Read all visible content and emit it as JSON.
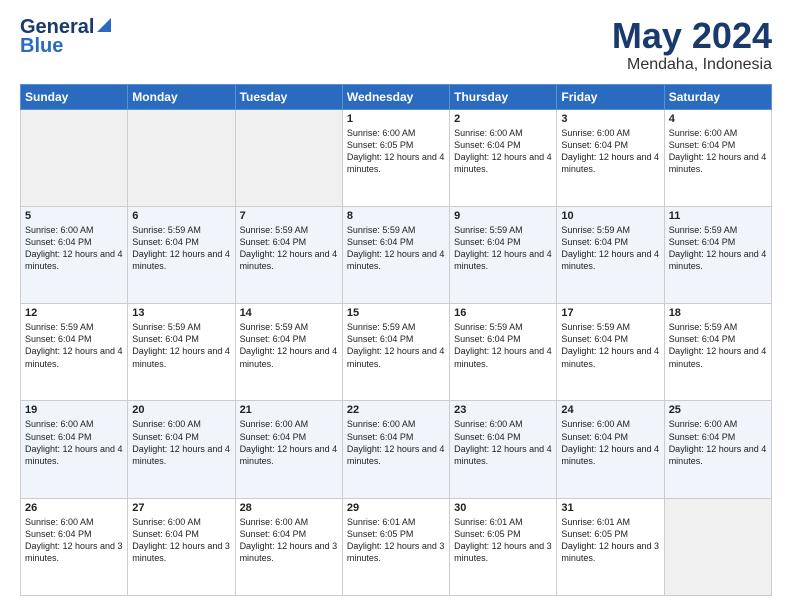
{
  "logo": {
    "line1": "General",
    "line2": "Blue"
  },
  "title": "May 2024",
  "location": "Mendaha, Indonesia",
  "days_header": [
    "Sunday",
    "Monday",
    "Tuesday",
    "Wednesday",
    "Thursday",
    "Friday",
    "Saturday"
  ],
  "weeks": [
    [
      {
        "day": "",
        "empty": true
      },
      {
        "day": "",
        "empty": true
      },
      {
        "day": "",
        "empty": true
      },
      {
        "day": "1",
        "sunrise": "6:00 AM",
        "sunset": "6:05 PM",
        "daylight": "12 hours and 4 minutes."
      },
      {
        "day": "2",
        "sunrise": "6:00 AM",
        "sunset": "6:04 PM",
        "daylight": "12 hours and 4 minutes."
      },
      {
        "day": "3",
        "sunrise": "6:00 AM",
        "sunset": "6:04 PM",
        "daylight": "12 hours and 4 minutes."
      },
      {
        "day": "4",
        "sunrise": "6:00 AM",
        "sunset": "6:04 PM",
        "daylight": "12 hours and 4 minutes."
      }
    ],
    [
      {
        "day": "5",
        "sunrise": "6:00 AM",
        "sunset": "6:04 PM",
        "daylight": "12 hours and 4 minutes."
      },
      {
        "day": "6",
        "sunrise": "5:59 AM",
        "sunset": "6:04 PM",
        "daylight": "12 hours and 4 minutes."
      },
      {
        "day": "7",
        "sunrise": "5:59 AM",
        "sunset": "6:04 PM",
        "daylight": "12 hours and 4 minutes."
      },
      {
        "day": "8",
        "sunrise": "5:59 AM",
        "sunset": "6:04 PM",
        "daylight": "12 hours and 4 minutes."
      },
      {
        "day": "9",
        "sunrise": "5:59 AM",
        "sunset": "6:04 PM",
        "daylight": "12 hours and 4 minutes."
      },
      {
        "day": "10",
        "sunrise": "5:59 AM",
        "sunset": "6:04 PM",
        "daylight": "12 hours and 4 minutes."
      },
      {
        "day": "11",
        "sunrise": "5:59 AM",
        "sunset": "6:04 PM",
        "daylight": "12 hours and 4 minutes."
      }
    ],
    [
      {
        "day": "12",
        "sunrise": "5:59 AM",
        "sunset": "6:04 PM",
        "daylight": "12 hours and 4 minutes."
      },
      {
        "day": "13",
        "sunrise": "5:59 AM",
        "sunset": "6:04 PM",
        "daylight": "12 hours and 4 minutes."
      },
      {
        "day": "14",
        "sunrise": "5:59 AM",
        "sunset": "6:04 PM",
        "daylight": "12 hours and 4 minutes."
      },
      {
        "day": "15",
        "sunrise": "5:59 AM",
        "sunset": "6:04 PM",
        "daylight": "12 hours and 4 minutes."
      },
      {
        "day": "16",
        "sunrise": "5:59 AM",
        "sunset": "6:04 PM",
        "daylight": "12 hours and 4 minutes."
      },
      {
        "day": "17",
        "sunrise": "5:59 AM",
        "sunset": "6:04 PM",
        "daylight": "12 hours and 4 minutes."
      },
      {
        "day": "18",
        "sunrise": "5:59 AM",
        "sunset": "6:04 PM",
        "daylight": "12 hours and 4 minutes."
      }
    ],
    [
      {
        "day": "19",
        "sunrise": "6:00 AM",
        "sunset": "6:04 PM",
        "daylight": "12 hours and 4 minutes."
      },
      {
        "day": "20",
        "sunrise": "6:00 AM",
        "sunset": "6:04 PM",
        "daylight": "12 hours and 4 minutes."
      },
      {
        "day": "21",
        "sunrise": "6:00 AM",
        "sunset": "6:04 PM",
        "daylight": "12 hours and 4 minutes."
      },
      {
        "day": "22",
        "sunrise": "6:00 AM",
        "sunset": "6:04 PM",
        "daylight": "12 hours and 4 minutes."
      },
      {
        "day": "23",
        "sunrise": "6:00 AM",
        "sunset": "6:04 PM",
        "daylight": "12 hours and 4 minutes."
      },
      {
        "day": "24",
        "sunrise": "6:00 AM",
        "sunset": "6:04 PM",
        "daylight": "12 hours and 4 minutes."
      },
      {
        "day": "25",
        "sunrise": "6:00 AM",
        "sunset": "6:04 PM",
        "daylight": "12 hours and 4 minutes."
      }
    ],
    [
      {
        "day": "26",
        "sunrise": "6:00 AM",
        "sunset": "6:04 PM",
        "daylight": "12 hours and 3 minutes."
      },
      {
        "day": "27",
        "sunrise": "6:00 AM",
        "sunset": "6:04 PM",
        "daylight": "12 hours and 3 minutes."
      },
      {
        "day": "28",
        "sunrise": "6:00 AM",
        "sunset": "6:04 PM",
        "daylight": "12 hours and 3 minutes."
      },
      {
        "day": "29",
        "sunrise": "6:01 AM",
        "sunset": "6:05 PM",
        "daylight": "12 hours and 3 minutes."
      },
      {
        "day": "30",
        "sunrise": "6:01 AM",
        "sunset": "6:05 PM",
        "daylight": "12 hours and 3 minutes."
      },
      {
        "day": "31",
        "sunrise": "6:01 AM",
        "sunset": "6:05 PM",
        "daylight": "12 hours and 3 minutes."
      },
      {
        "day": "",
        "empty": true
      }
    ]
  ]
}
